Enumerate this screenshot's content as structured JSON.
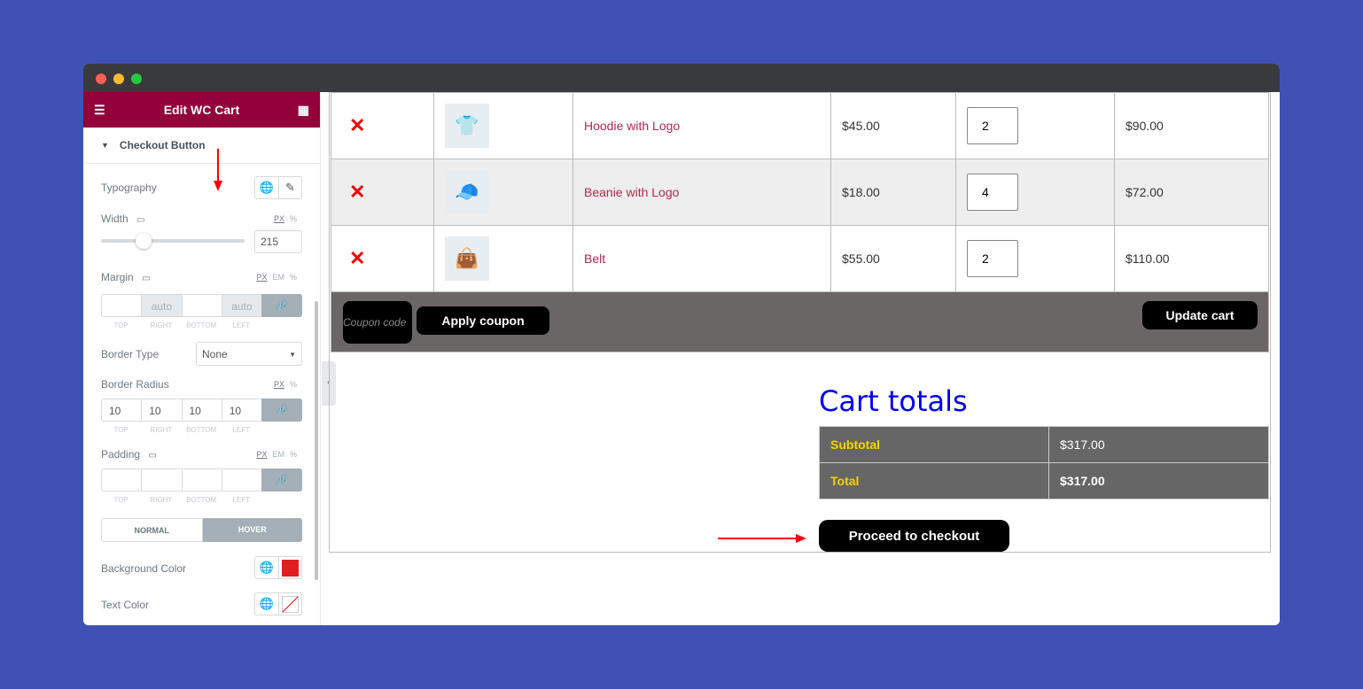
{
  "window": {
    "controls": [
      "close",
      "minimize",
      "maximize"
    ]
  },
  "sidebar": {
    "title": "Edit WC Cart",
    "section": "Checkout Button",
    "typography_label": "Typography",
    "width": {
      "label": "Width",
      "units": [
        "PX",
        "%"
      ],
      "value": "215",
      "slider_fraction": 0.29
    },
    "margin": {
      "label": "Margin",
      "units": [
        "PX",
        "EM",
        "%"
      ],
      "values": [
        "",
        "auto",
        "",
        "auto"
      ],
      "sides": [
        "TOP",
        "RIGHT",
        "BOTTOM",
        "LEFT"
      ]
    },
    "border_type": {
      "label": "Border Type",
      "value": "None"
    },
    "border_radius": {
      "label": "Border Radius",
      "units": [
        "PX",
        "%"
      ],
      "values": [
        "10",
        "10",
        "10",
        "10"
      ]
    },
    "padding": {
      "label": "Padding",
      "units": [
        "PX",
        "EM",
        "%"
      ],
      "values": [
        "",
        "",
        "",
        ""
      ]
    },
    "tabs": [
      "NORMAL",
      "HOVER"
    ],
    "active_tab": "HOVER",
    "bg_color": {
      "label": "Background Color",
      "value": "#dd1f1f"
    },
    "text_color": {
      "label": "Text Color"
    }
  },
  "cart": {
    "rows": [
      {
        "product": "Hoodie with Logo",
        "price": "$45.00",
        "qty": "2",
        "subtotal": "$90.00",
        "thumb": "👕"
      },
      {
        "product": "Beanie with Logo",
        "price": "$18.00",
        "qty": "4",
        "subtotal": "$72.00",
        "thumb": "🧢"
      },
      {
        "product": "Belt",
        "price": "$55.00",
        "qty": "2",
        "subtotal": "$110.00",
        "thumb": "👜"
      }
    ],
    "coupon_placeholder": "Coupon code",
    "apply_coupon": "Apply coupon",
    "update_cart": "Update cart"
  },
  "totals": {
    "title": "Cart totals",
    "subtotal_label": "Subtotal",
    "subtotal": "$317.00",
    "total_label": "Total",
    "total": "$317.00",
    "checkout": "Proceed to checkout"
  },
  "colors": {
    "brand": "#93003a",
    "label": "#f5d300",
    "heading": "#0000ee",
    "annotation": "#ff0000"
  }
}
